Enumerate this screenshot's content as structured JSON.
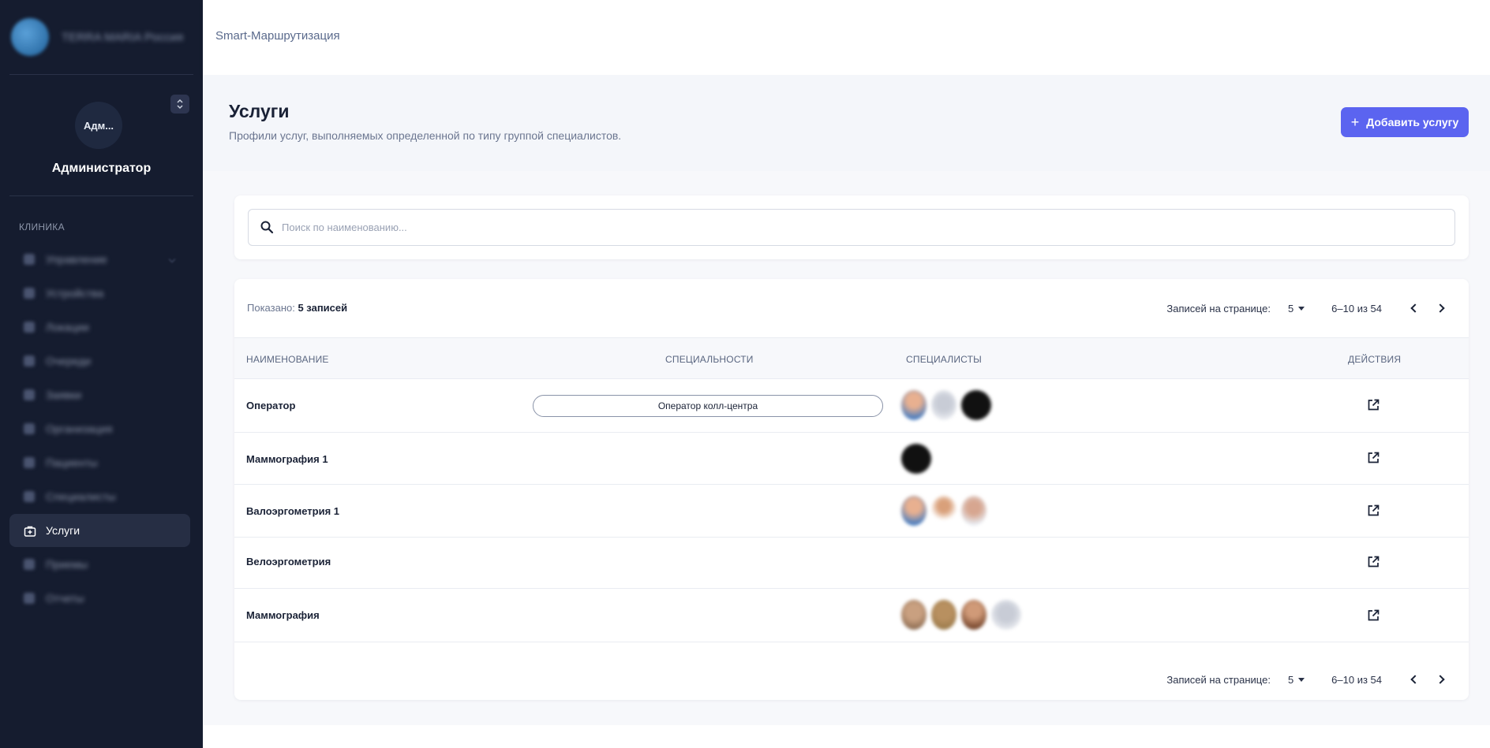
{
  "sidebar": {
    "brand_name": "TERRA MARIA Россия",
    "avatar_text": "Адм...",
    "role": "Администратор",
    "section_label": "КЛИНИКА",
    "items": [
      {
        "label": "Управление",
        "active": false
      },
      {
        "label": "Устройства",
        "active": false
      },
      {
        "label": "Локации",
        "active": false
      },
      {
        "label": "Очереди",
        "active": false
      },
      {
        "label": "Заявки",
        "active": false
      },
      {
        "label": "Организация",
        "active": false
      },
      {
        "label": "Пациенты",
        "active": false
      },
      {
        "label": "Специалисты",
        "active": false
      },
      {
        "label": "Услуги",
        "active": true
      },
      {
        "label": "Приемы",
        "active": false
      },
      {
        "label": "Отчеты",
        "active": false
      }
    ]
  },
  "topbar": {
    "title": "Smart-Маршрутизация"
  },
  "header": {
    "title": "Услуги",
    "subtitle": "Профили услуг, выполняемых определенной по типу группой специалистов.",
    "add_button_label": "Добавить услугу"
  },
  "search": {
    "placeholder": "Поиск по наименованию...",
    "value": ""
  },
  "table": {
    "shown_label": "Показано:",
    "shown_count": "5 записей",
    "per_page_label": "Записей на странице:",
    "per_page_value": "5",
    "range": "6–10 из 54",
    "columns": {
      "name": "Наименование",
      "specialties": "Специальности",
      "specialists": "Специалисты",
      "actions": "Действия"
    },
    "rows": [
      {
        "name": "Оператор",
        "specialty": "Оператор колл-центра"
      },
      {
        "name": "Маммография 1",
        "specialty": ""
      },
      {
        "name": "Валоэргометрия 1",
        "specialty": ""
      },
      {
        "name": "Велоэргометрия",
        "specialty": ""
      },
      {
        "name": "Маммография",
        "specialty": ""
      }
    ]
  },
  "colors": {
    "sidebar_bg": "#151c2f",
    "accent": "#5b64f0",
    "active_item_bg": "#262e44"
  }
}
